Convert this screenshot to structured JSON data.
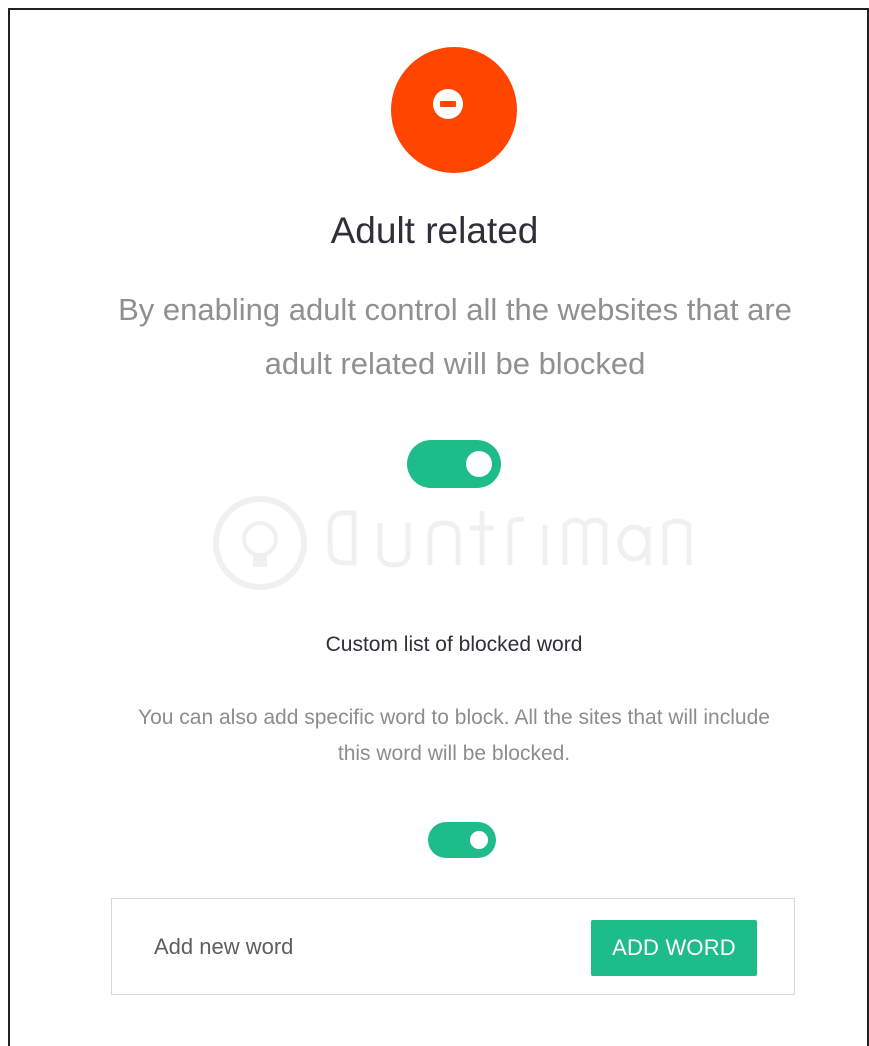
{
  "header": {
    "icon": "minus-circle-icon",
    "icon_color": "#ff4500",
    "title": "Adult related",
    "description": "By enabling adult control all the websites that are adult related will be blocked"
  },
  "adult_control": {
    "enabled": true,
    "toggle_color": "#1fbc8b"
  },
  "custom_list": {
    "title": "Custom list of blocked word",
    "description": "You can also add specific word to block. All the sites that will include this word will be blocked.",
    "enabled": true,
    "input_placeholder": "Add new word",
    "input_value": "",
    "add_button_label": "ADD WORD",
    "accent_color": "#1fbc8b"
  }
}
